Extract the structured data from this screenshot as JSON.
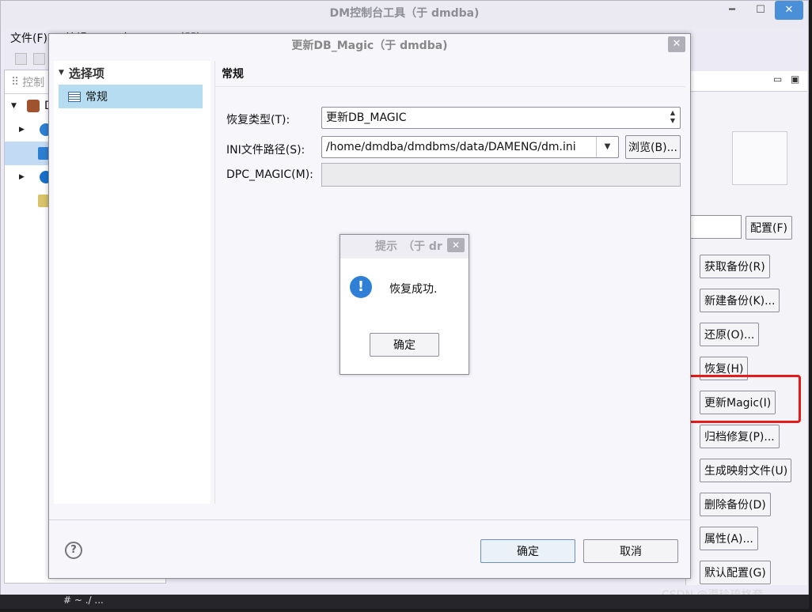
{
  "main_window": {
    "title": "DM控制台工具（于 dmdba)",
    "menu": [
      "文件(F)",
      "编辑(E)",
      "窗口(W)",
      "帮助(H)"
    ]
  },
  "navigator": {
    "tab_label": "控制",
    "root_label": "D"
  },
  "right_panel": {
    "config_button": "配置(F)",
    "buttons": [
      "获取备份(R)",
      "新建备份(K)...",
      "还原(O)...",
      "恢复(H)",
      "更新Magic(I)",
      "归档修复(P)...",
      "生成映射文件(U)",
      "删除备份(D)",
      "属性(A)...",
      "默认配置(G)"
    ],
    "highlighted": "更新Magic(I)"
  },
  "dialog": {
    "title": "更新DB_Magic（于 dmdba)",
    "options_header": "选择项",
    "options": [
      "常规"
    ],
    "section_title": "常规",
    "restore_type_label": "恢复类型(T):",
    "restore_type_value": "更新DB_MAGIC",
    "ini_path_label": "INI文件路径(S):",
    "ini_path_value": "/home/dmdba/dmdbms/data/DAMENG/dm.ini",
    "browse_button": "浏览(B)...",
    "dpc_magic_label": "DPC_MAGIC(M):",
    "dpc_magic_value": "",
    "ok_button": "确定",
    "cancel_button": "取消",
    "help_icon": "?"
  },
  "message_box": {
    "title": "提示　（于 dr",
    "text": "恢复成功.",
    "ok_button": "确定",
    "icon": "info-icon"
  },
  "watermark": "CSDN @渠玲琉格套",
  "bottom_text": "# ~ ./ ..."
}
